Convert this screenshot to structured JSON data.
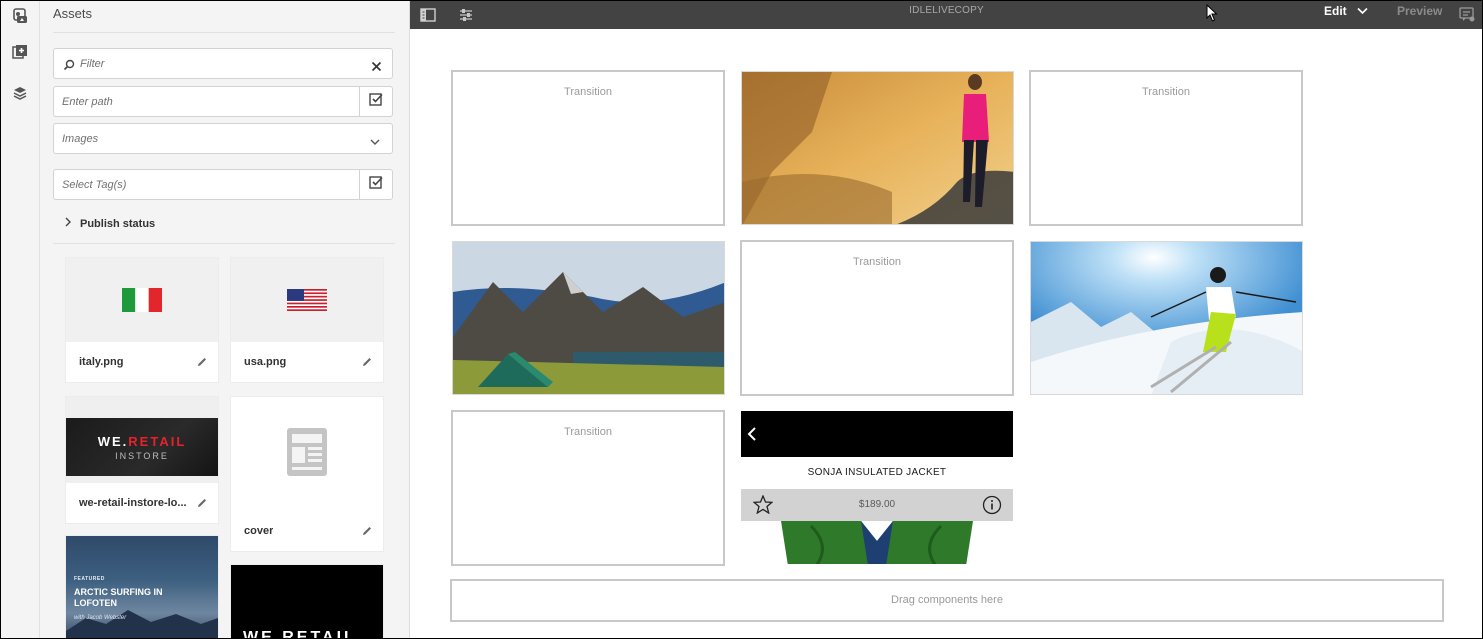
{
  "rail": {
    "items": [
      "assets-icon",
      "components-icon",
      "content-tree-icon"
    ]
  },
  "panel": {
    "title": "Assets",
    "filter": {
      "placeholder": "Filter"
    },
    "path": {
      "placeholder": "Enter path"
    },
    "type_select": {
      "value": "Images"
    },
    "tags": {
      "placeholder": "Select Tag(s)"
    },
    "publish_status": "Publish status",
    "assets": [
      {
        "name": "italy.png"
      },
      {
        "name": "usa.png"
      },
      {
        "name": "we-retail-instore-lo..."
      },
      {
        "name": "cover"
      },
      {
        "name": "",
        "thumb_text": [
          "FEATURED",
          "ARCTIC SURFING IN",
          "LOFOTEN",
          "with Jacob Webster"
        ]
      },
      {
        "name": "",
        "thumb_text": [
          "WE.RETAIL"
        ]
      }
    ],
    "logo_text": {
      "we": "WE.",
      "retail": "RETAIL",
      "instore": "INSTORE"
    }
  },
  "topbar": {
    "title": "IDLELIVECOPY",
    "mode": "Edit",
    "preview": "Preview"
  },
  "canvas": {
    "transition_label": "Transition",
    "product": {
      "name": "SONJA INSULATED JACKET",
      "price": "$189.00"
    },
    "drop_zone": "Drag components here"
  },
  "colors": {
    "topbar_bg": "#434343",
    "panel_bg": "#f4f4f4",
    "brand_red": "#e8212a"
  }
}
